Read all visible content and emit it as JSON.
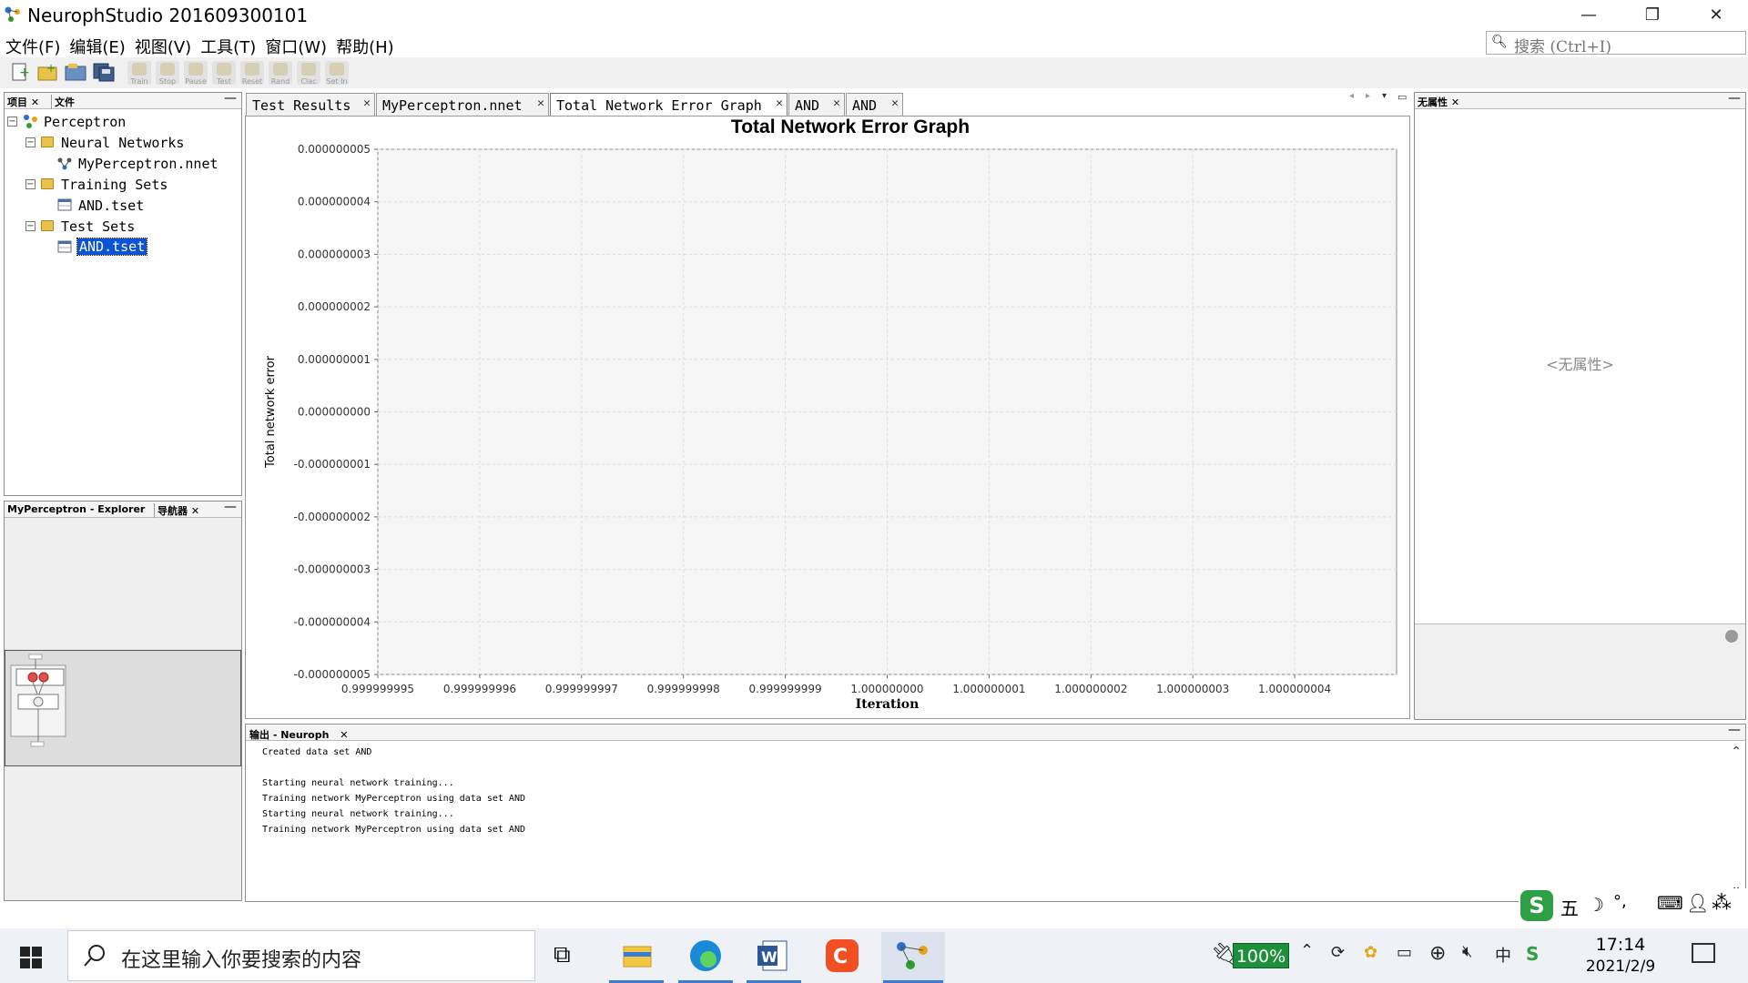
{
  "window": {
    "title": "NeurophStudio 201609300101"
  },
  "menu": [
    "文件(F)",
    "编辑(E)",
    "视图(V)",
    "工具(T)",
    "窗口(W)",
    "帮助(H)"
  ],
  "search": {
    "placeholder": "搜索 (Ctrl+I)"
  },
  "toolbar": {
    "labels": [
      "Train",
      "Stop",
      "Pause",
      "Test",
      "Reset",
      "Rand",
      "Clac",
      "Set In"
    ]
  },
  "project_panel": {
    "tabs": [
      "项目",
      "文件"
    ],
    "tree": [
      "Perceptron",
      "Neural Networks",
      "MyPerceptron.nnet",
      "Training Sets",
      "AND.tset",
      "Test Sets",
      "AND.tset"
    ]
  },
  "navigator_panel": {
    "tabs": [
      "MyPerceptron - Explorer",
      "导航器"
    ]
  },
  "editor_tabs": [
    "Test Results",
    "MyPerceptron.nnet",
    "Total Network Error Graph",
    "AND",
    "AND"
  ],
  "properties_panel": {
    "tab": "无属性",
    "empty_text": "<无属性>"
  },
  "chart_data": {
    "type": "line",
    "title": "Total Network Error Graph",
    "xlabel": "Iteration",
    "ylabel": "Total network error",
    "x_ticks": [
      "0.999999995",
      "0.999999996",
      "0.999999997",
      "0.999999998",
      "0.999999999",
      "1.000000000",
      "1.000000001",
      "1.000000002",
      "1.000000003",
      "1.000000004"
    ],
    "y_ticks": [
      "0.000000005",
      "0.000000004",
      "0.000000003",
      "0.000000002",
      "0.000000001",
      "0.000000000",
      "-0.000000001",
      "-0.000000002",
      "-0.000000003",
      "-0.000000004",
      "-0.000000005"
    ],
    "xlim": [
      0.999999995,
      1.000000005
    ],
    "ylim": [
      -5e-09,
      5e-09
    ],
    "series": [],
    "grid": true
  },
  "output_panel": {
    "tab": "输出 - Neuroph",
    "lines": [
      "Created data set AND",
      "",
      "Starting neural network training...",
      "Training network MyPerceptron using data set AND",
      "Starting neural network training...",
      "Training network MyPerceptron using data set AND"
    ]
  },
  "ime": {
    "label": "五"
  },
  "taskbar": {
    "search_placeholder": "在这里输入你要搜索的内容",
    "battery": "100%",
    "clock_time": "17:14",
    "clock_date": "2021/2/9",
    "ime_lang": "中"
  },
  "colors": {
    "selection": "#0a52d6",
    "accent": "#2e7d32"
  }
}
